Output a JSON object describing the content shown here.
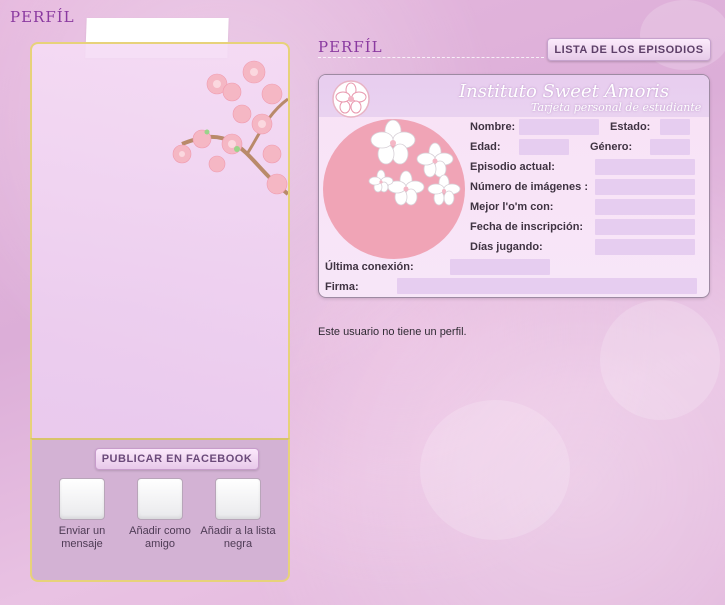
{
  "left_panel": {
    "title": "PERFÍL",
    "facebook_button": "PUBLICAR EN FACEBOOK",
    "actions": [
      {
        "label": "Enviar un mensaje"
      },
      {
        "label": "Añadir como amigo"
      },
      {
        "label": "Añadir a la lista negra"
      }
    ]
  },
  "right_panel": {
    "title": "PERFÍL",
    "episodes_button": "LISTA DE LOS EPISODIOS",
    "card": {
      "institution": "Instituto Sweet Amoris",
      "subtitle": "Tarjeta personal de estudiante",
      "fields": {
        "nombre": "Nombre:",
        "estado": "Estado:",
        "edad": "Edad:",
        "genero": "Género:",
        "episodio": "Episodio actual:",
        "imagenes": "Número de imágenes :",
        "mejor": "Mejor l'o'm con:",
        "fecha": "Fecha de inscripción:",
        "dias": "Días jugando:",
        "ultima": "Última conexión:",
        "firma": "Firma:"
      }
    },
    "no_profile_text": "Este usuario no tiene un perfil."
  },
  "colors": {
    "title_purple": "#8a3aa0",
    "frame_gold": "#e7d27a",
    "card_pink": "#f0a4b6"
  }
}
